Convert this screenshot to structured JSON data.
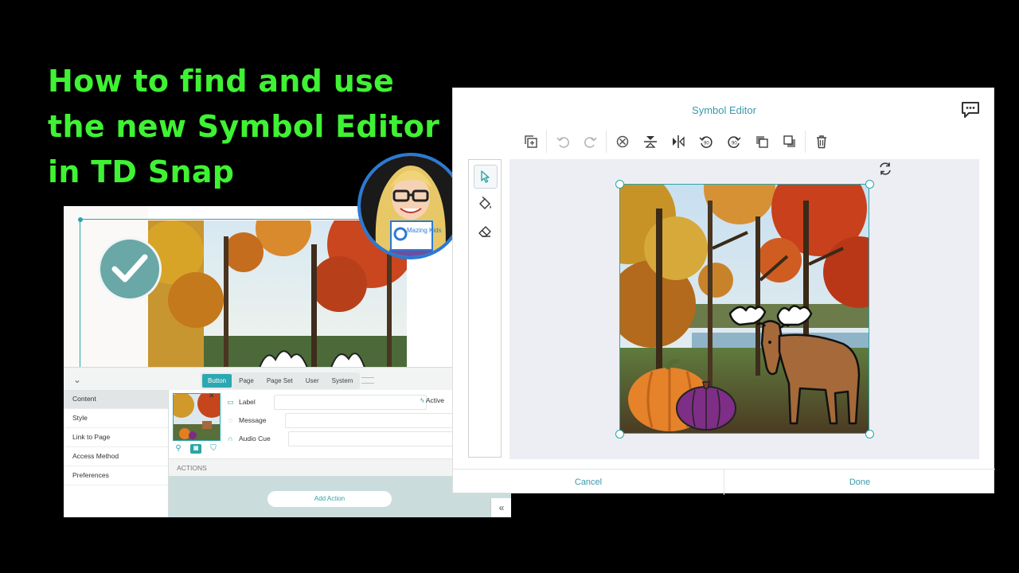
{
  "headline": {
    "line1": "How to find and use",
    "line2": "the new Symbol Editor",
    "line3": "in TD Snap"
  },
  "colors": {
    "headline": "#3ff233",
    "accent": "#2aa5a8",
    "avatar_ring": "#2a7ad6"
  },
  "avatar": {
    "badge_text": "Mazing Kids",
    "icon": "teacher-avatar-with-glasses"
  },
  "snap_editor": {
    "tabs": [
      {
        "label": "Button",
        "active": true
      },
      {
        "label": "Page",
        "active": false
      },
      {
        "label": "Page Set",
        "active": false
      },
      {
        "label": "User",
        "active": false
      },
      {
        "label": "System",
        "active": false
      }
    ],
    "sidebar": [
      "Content",
      "Style",
      "Link to Page",
      "Access Method",
      "Preferences"
    ],
    "fields": {
      "label": "Label",
      "message": "Message",
      "audio_cue": "Audio Cue",
      "active": "Active"
    },
    "actions_header": "ACTIONS",
    "add_action": "Add Action",
    "collapse_glyph": "⌄",
    "expand_glyph": "«"
  },
  "symbol_editor": {
    "title": "Symbol Editor",
    "toolbar_icons": [
      "duplicate-icon",
      "undo-icon",
      "redo-icon",
      "remove-background-icon",
      "flip-vertical-icon",
      "flip-horizontal-icon",
      "rotate-left-icon",
      "rotate-right-icon",
      "bring-forward-icon",
      "send-backward-icon",
      "delete-icon"
    ],
    "tools": [
      "select-pointer-icon",
      "paint-bucket-icon",
      "eraser-icon"
    ],
    "cancel": "Cancel",
    "done": "Done"
  }
}
